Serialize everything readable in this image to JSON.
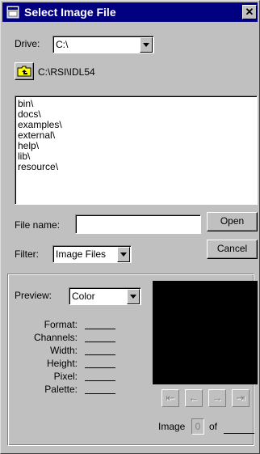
{
  "window": {
    "title": "Select Image File",
    "close_glyph": "✕",
    "icon": "dialog-window-icon"
  },
  "drive": {
    "label": "Drive:",
    "value": "C:\\"
  },
  "path": {
    "icon": "folder-up-icon",
    "text": "C:\\RSI\\IDL54"
  },
  "directory_list": {
    "items": [
      "bin\\",
      "docs\\",
      "examples\\",
      "external\\",
      "help\\",
      "lib\\",
      "resource\\"
    ]
  },
  "file": {
    "name_label": "File name:",
    "name_value": "",
    "filter_label": "Filter:",
    "filter_value": "Image Files",
    "open_label": "Open",
    "cancel_label": "Cancel"
  },
  "preview": {
    "label": "Preview:",
    "value": "Color",
    "fields": [
      {
        "label": "Format:",
        "value": ""
      },
      {
        "label": "Channels:",
        "value": ""
      },
      {
        "label": "Width:",
        "value": ""
      },
      {
        "label": "Height:",
        "value": ""
      },
      {
        "label": "Pixel:",
        "value": ""
      },
      {
        "label": "Palette:",
        "value": ""
      }
    ],
    "nav": {
      "first_glyph": "⇤",
      "prev_glyph": "←",
      "next_glyph": "→",
      "last_glyph": "⇥"
    },
    "image_label": "Image",
    "image_index": "0",
    "of_label": "of",
    "image_total": ""
  },
  "colors": {
    "title_bar": "#000080",
    "dialog_bg": "#c0c0c0",
    "preview_bg": "#000000"
  }
}
